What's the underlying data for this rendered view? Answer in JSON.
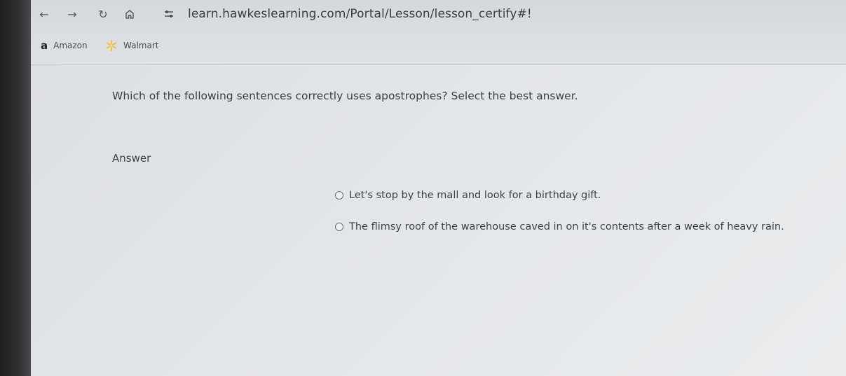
{
  "browser": {
    "url": "learn.hawkeslearning.com/Portal/Lesson/lesson_certify#!",
    "bookmarks": [
      {
        "label": "Amazon",
        "icon": "amazon-icon"
      },
      {
        "label": "Walmart",
        "icon": "walmart-spark-icon"
      }
    ],
    "walmart_color": "#f2c230"
  },
  "question": {
    "text": "Which of the following sentences correctly uses apostrophes? Select the best answer.",
    "answer_label": "Answer",
    "options": [
      "Let's stop by the mall and look for a birthday gift.",
      "The flimsy roof of the warehouse caved in on it's contents after a week of heavy rain."
    ]
  }
}
